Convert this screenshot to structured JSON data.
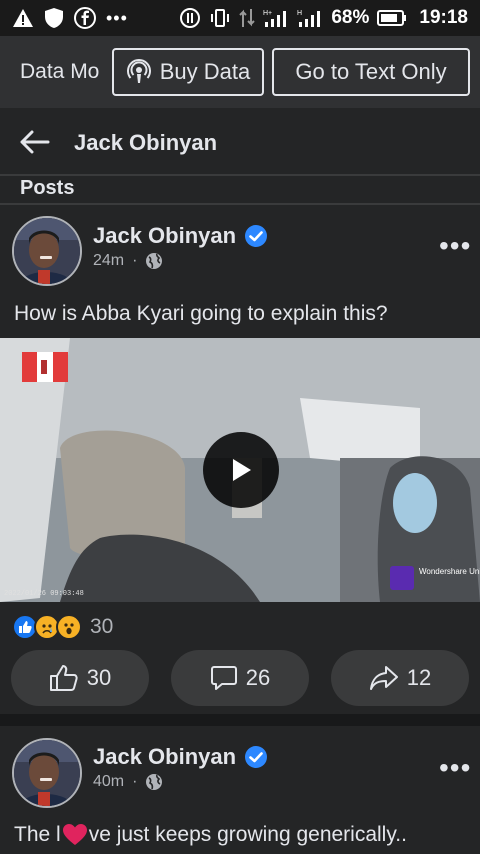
{
  "status_bar": {
    "battery": "68%",
    "time": "19:18",
    "icons": [
      "warning-icon",
      "shield-icon",
      "facebook-icon",
      "more-dots-icon",
      "mute-icon",
      "vibrate-icon",
      "data-transfer-icon",
      "signal-icon",
      "signal-icon",
      "battery-icon"
    ]
  },
  "data_bar": {
    "data_mode": "Data Mo",
    "buy_data": "Buy Data",
    "text_only": "Go to Text Only"
  },
  "header": {
    "title": "Jack Obinyan"
  },
  "section": {
    "label": "Posts"
  },
  "posts": [
    {
      "author": "Jack Obinyan",
      "time": "24m",
      "text": "How is Abba Kyari going to explain this?",
      "reaction_count": "30",
      "likes": "30",
      "comments": "26",
      "shares": "12",
      "video_watermark": "Wondershare UniConverter",
      "video_timestamp": "2022/01/26 09:03:48"
    },
    {
      "author": "Jack Obinyan",
      "time": "40m",
      "text_before": "The l",
      "text_after": "ve just keeps growing generically.."
    }
  ],
  "colors": {
    "verified": "#2d88ff",
    "like": "#1877f2",
    "love": "#f33e58",
    "haha": "#f7b125"
  }
}
